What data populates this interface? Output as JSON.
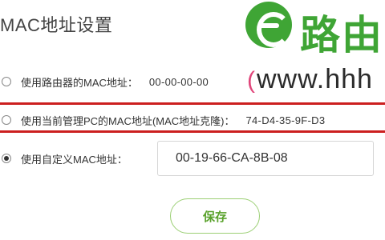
{
  "page": {
    "title": "MAC地址设置"
  },
  "watermark": {
    "logo_text": "路由",
    "url_paren": "(",
    "url_text": "www.hhh"
  },
  "options": [
    {
      "label": "使用路由器的MAC地址：",
      "value": "00-00-00-00",
      "selected": false
    },
    {
      "label": "使用当前管理PC的MAC地址(MAC地址克隆)：",
      "value": "74-D4-35-9F-D3",
      "selected": false,
      "highlighted": true
    },
    {
      "label": "使用自定义MAC地址：",
      "selected": true
    }
  ],
  "custom_mac_input": {
    "value": "00-19-66-CA-8B-08"
  },
  "save_button": {
    "label": "保存"
  },
  "colors": {
    "brand_green": "#3fa535",
    "highlight_red": "#cc1f1f",
    "button_green": "#5aa22c"
  }
}
